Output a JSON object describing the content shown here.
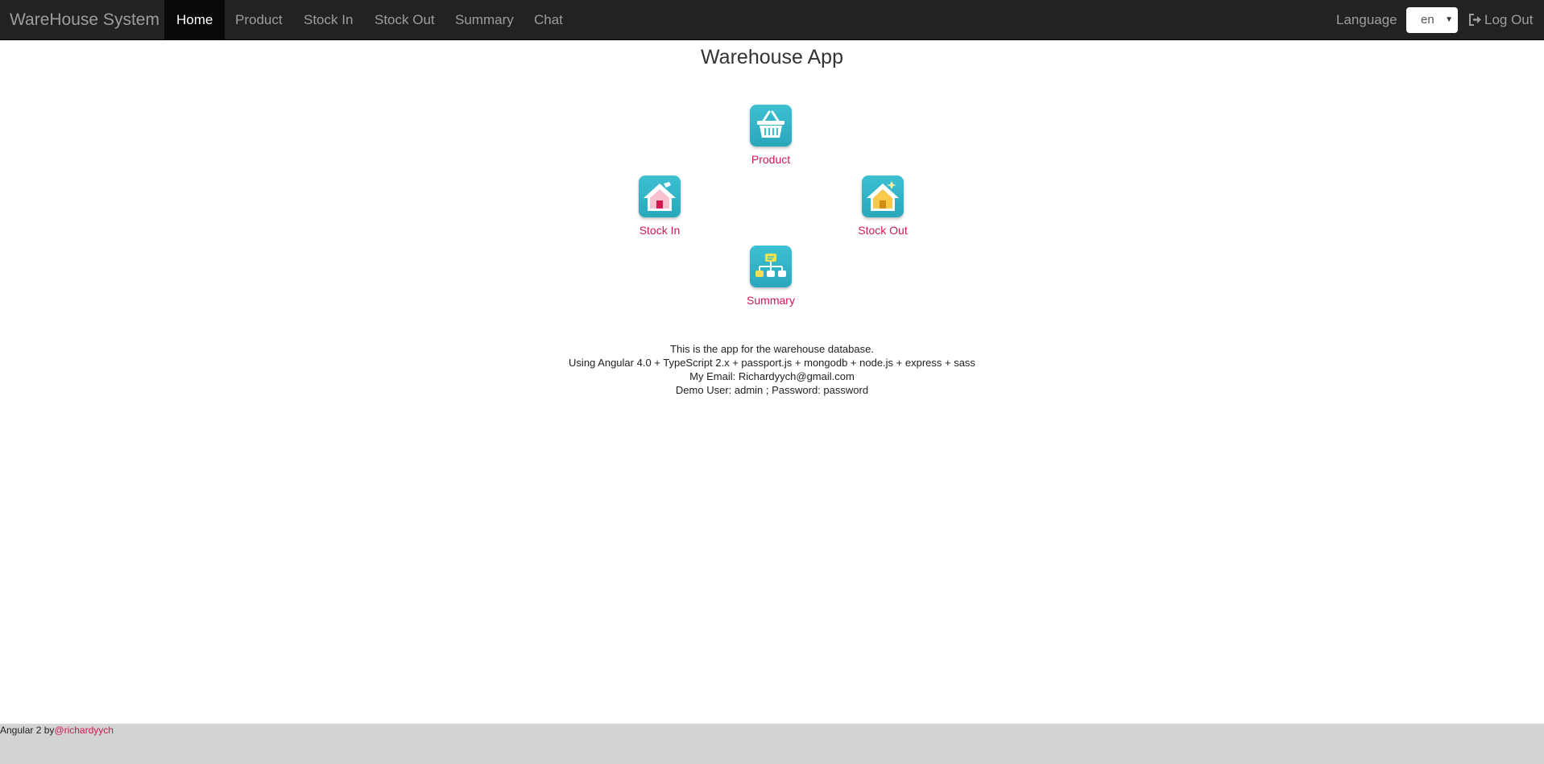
{
  "navbar": {
    "brand": "WareHouse System",
    "items": [
      {
        "label": "Home",
        "active": true
      },
      {
        "label": "Product",
        "active": false
      },
      {
        "label": "Stock In",
        "active": false
      },
      {
        "label": "Stock Out",
        "active": false
      },
      {
        "label": "Summary",
        "active": false
      },
      {
        "label": "Chat",
        "active": false
      }
    ],
    "language_label": "Language",
    "language_value": "en",
    "logout_label": "Log Out"
  },
  "main": {
    "title": "Warehouse App",
    "tiles": [
      {
        "label": "Product",
        "icon": "basket-icon"
      },
      {
        "label": "Stock In",
        "icon": "house-in-icon"
      },
      {
        "label": "Stock Out",
        "icon": "house-out-icon"
      },
      {
        "label": "Summary",
        "icon": "org-chart-icon"
      }
    ],
    "info_lines": [
      "This is the app for the warehouse database.",
      "Using Angular 4.0 + TypeScript 2.x + passport.js + mongodb + node.js + express + sass",
      "My Email: Richardyych@gmail.com",
      "Demo User: admin ; Password: password"
    ]
  },
  "footer": {
    "text": "Angular 2 by",
    "link": "@richardyych"
  },
  "colors": {
    "navbar_bg": "#222222",
    "nav_active_bg": "#080808",
    "accent": "#d1184f",
    "tile_bg": "#3cc0d2",
    "footer_bg": "#d3d3d3"
  }
}
